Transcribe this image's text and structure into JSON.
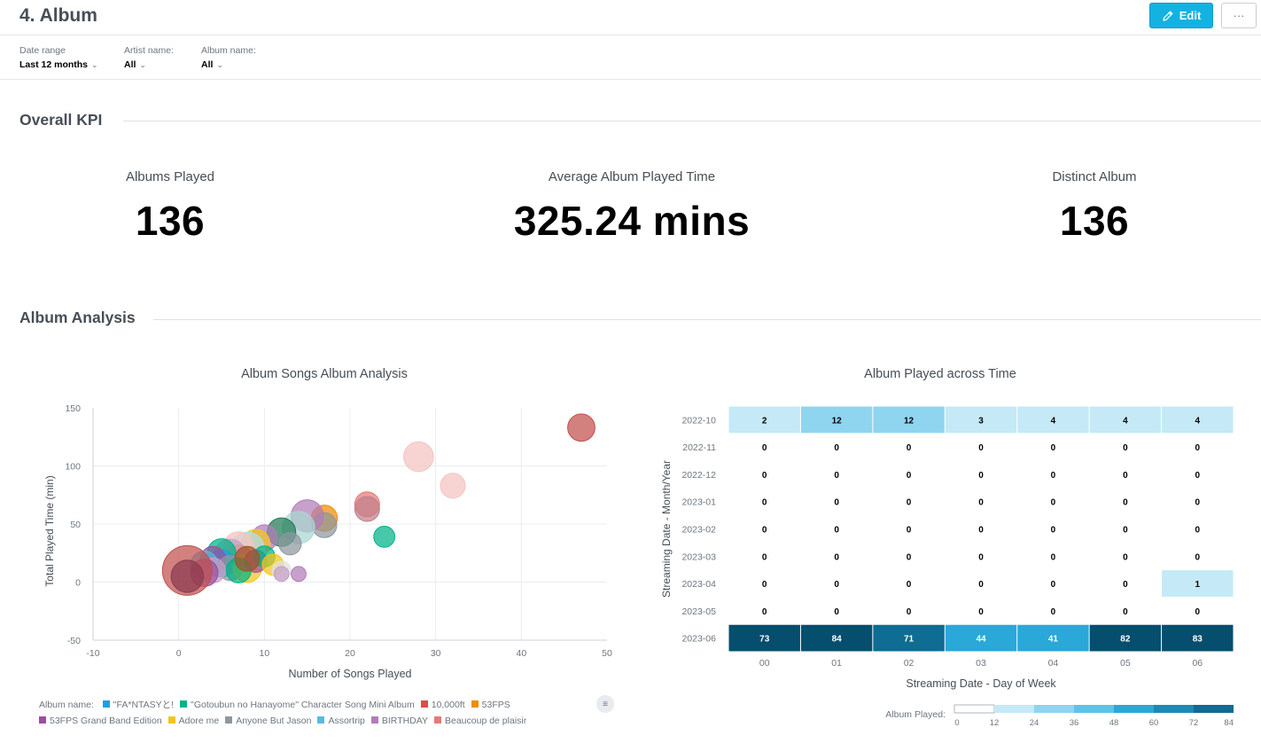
{
  "header": {
    "title": "4. Album",
    "edit_label": "Edit",
    "more_label": "···"
  },
  "filters": [
    {
      "label": "Date range",
      "value": "Last 12 months"
    },
    {
      "label": "Artist name:",
      "value": "All"
    },
    {
      "label": "Album name:",
      "value": "All"
    }
  ],
  "sections": {
    "kpi_title": "Overall KPI",
    "analysis_title": "Album Analysis"
  },
  "kpis": [
    {
      "label": "Albums Played",
      "value": "136"
    },
    {
      "label": "Average Album Played Time",
      "value": "325.24 mins"
    },
    {
      "label": "Distinct Album",
      "value": "136"
    }
  ],
  "chart_data": [
    {
      "type": "scatter",
      "title": "Album Songs Album Analysis",
      "xlabel": "Number of Songs Played",
      "ylabel": "Total Played Time (min)",
      "xlim": [
        -10,
        50
      ],
      "ylim": [
        -50,
        150
      ],
      "xticks": [
        "-10",
        "0",
        "10",
        "20",
        "30",
        "40",
        "50"
      ],
      "yticks": [
        "150",
        "100",
        "50",
        "0",
        "-50"
      ],
      "grid": true,
      "legend_position": "bottom",
      "legend_title": "Album name:",
      "legend": [
        {
          "name": "\"FA*NTASYと!",
          "color": "#20a0e0"
        },
        {
          "name": "\"Gotoubun no Hanayome\" Character Song Mini Album",
          "color": "#00b386"
        },
        {
          "name": "10,000ft",
          "color": "#e34a4a"
        },
        {
          "name": "53FPS",
          "color": "#f08c00"
        },
        {
          "name": "53FPS Grand Band Edition",
          "color": "#9b4f9e"
        },
        {
          "name": "Adore me",
          "color": "#f5c518"
        },
        {
          "name": "Anyone But Jason",
          "color": "#8e979f"
        },
        {
          "name": "Assortrip",
          "color": "#5cb8e0"
        },
        {
          "name": "BIRTHDAY",
          "color": "#b27cb8"
        },
        {
          "name": "Beaucoup de plaisir",
          "color": "#e87878"
        }
      ],
      "points": [
        {
          "x": 47,
          "y": 133,
          "size": 2.2,
          "color": "#c0504d"
        },
        {
          "x": 28,
          "y": 108,
          "size": 2.4,
          "color": "#f4c4c0"
        },
        {
          "x": 32,
          "y": 83,
          "size": 2.0,
          "color": "#f4c4c0"
        },
        {
          "x": 22,
          "y": 67,
          "size": 2.0,
          "color": "#e87878"
        },
        {
          "x": 22,
          "y": 63,
          "size": 2.0,
          "color": "#c0808a"
        },
        {
          "x": 17,
          "y": 55,
          "size": 2.1,
          "color": "#f08c00"
        },
        {
          "x": 17,
          "y": 49,
          "size": 2.0,
          "color": "#8e979f"
        },
        {
          "x": 15,
          "y": 57,
          "size": 2.6,
          "color": "#b27cb8"
        },
        {
          "x": 14,
          "y": 47,
          "size": 2.6,
          "color": "#a8d8d0"
        },
        {
          "x": 12,
          "y": 43,
          "size": 2.3,
          "color": "#207a55"
        },
        {
          "x": 13,
          "y": 33,
          "size": 1.8,
          "color": "#8e979f"
        },
        {
          "x": 24,
          "y": 39,
          "size": 1.7,
          "color": "#00b386"
        },
        {
          "x": 10,
          "y": 38,
          "size": 2.1,
          "color": "#b27cb8"
        },
        {
          "x": 9,
          "y": 33,
          "size": 2.3,
          "color": "#f5c518"
        },
        {
          "x": 8,
          "y": 28,
          "size": 2.8,
          "color": "#ade0ee"
        },
        {
          "x": 7,
          "y": 30,
          "size": 2.5,
          "color": "#f4c4c0"
        },
        {
          "x": 7,
          "y": 20,
          "size": 2.2,
          "color": "#f08c00"
        },
        {
          "x": 6,
          "y": 23,
          "size": 2.6,
          "color": "#c5a0c8"
        },
        {
          "x": 5,
          "y": 25,
          "size": 2.3,
          "color": "#00b386"
        },
        {
          "x": 5,
          "y": 16,
          "size": 2.2,
          "color": "#20a0e0"
        },
        {
          "x": 4,
          "y": 20,
          "size": 2.0,
          "color": "#9b4f9e"
        },
        {
          "x": 3,
          "y": 15,
          "size": 2.2,
          "color": "#5cb8e0"
        },
        {
          "x": 6,
          "y": 12,
          "size": 2.0,
          "color": "#8e979f"
        },
        {
          "x": 8,
          "y": 12,
          "size": 2.3,
          "color": "#f5c518"
        },
        {
          "x": 9,
          "y": 18,
          "size": 1.8,
          "color": "#9b4f9e"
        },
        {
          "x": 10,
          "y": 22,
          "size": 1.7,
          "color": "#00b386"
        },
        {
          "x": 11,
          "y": 15,
          "size": 1.7,
          "color": "#f5c518"
        },
        {
          "x": 12,
          "y": 10,
          "size": 1.5,
          "color": "#e0e0e0"
        },
        {
          "x": 12,
          "y": 7,
          "size": 1.2,
          "color": "#c5a0c8"
        },
        {
          "x": 14,
          "y": 7,
          "size": 1.2,
          "color": "#b27cb8"
        },
        {
          "x": 7,
          "y": 10,
          "size": 2.0,
          "color": "#00b386"
        },
        {
          "x": 4,
          "y": 10,
          "size": 2.0,
          "color": "#c5a0c8"
        },
        {
          "x": 3,
          "y": 8,
          "size": 2.2,
          "color": "#9b4f9e"
        },
        {
          "x": 8,
          "y": 20,
          "size": 2.0,
          "color": "#a0522d"
        },
        {
          "x": 1,
          "y": 10,
          "size": 4.0,
          "color": "#c0504d"
        },
        {
          "x": 1,
          "y": 5,
          "size": 2.6,
          "color": "#8b3a50"
        }
      ]
    },
    {
      "type": "heatmap",
      "title": "Album Played across Time",
      "xlabel": "Streaming Date - Day of Week",
      "ylabel": "Streaming Date - Month/Year",
      "x": [
        "00",
        "01",
        "02",
        "03",
        "04",
        "05",
        "06"
      ],
      "y": [
        "2022-10",
        "2022-11",
        "2022-12",
        "2023-01",
        "2023-02",
        "2023-03",
        "2023-04",
        "2023-05",
        "2023-06"
      ],
      "values": [
        [
          2,
          12,
          12,
          3,
          4,
          4,
          4
        ],
        [
          0,
          0,
          0,
          0,
          0,
          0,
          0
        ],
        [
          0,
          0,
          0,
          0,
          0,
          0,
          0
        ],
        [
          0,
          0,
          0,
          0,
          0,
          0,
          0
        ],
        [
          0,
          0,
          0,
          0,
          0,
          0,
          0
        ],
        [
          0,
          0,
          0,
          0,
          0,
          0,
          0
        ],
        [
          0,
          0,
          0,
          0,
          0,
          0,
          1
        ],
        [
          0,
          0,
          0,
          0,
          0,
          0,
          0
        ],
        [
          73,
          84,
          71,
          44,
          41,
          82,
          83
        ]
      ],
      "color_scale": {
        "label": "Album Played:",
        "ticks": [
          "0",
          "12",
          "24",
          "36",
          "48",
          "60",
          "72",
          "84"
        ],
        "colors": [
          "#ffffff",
          "#c5e9f6",
          "#8fd5f0",
          "#5cc4ea",
          "#2aa8d8",
          "#1a8ab8",
          "#0f6c92",
          "#064e6e"
        ]
      }
    }
  ]
}
